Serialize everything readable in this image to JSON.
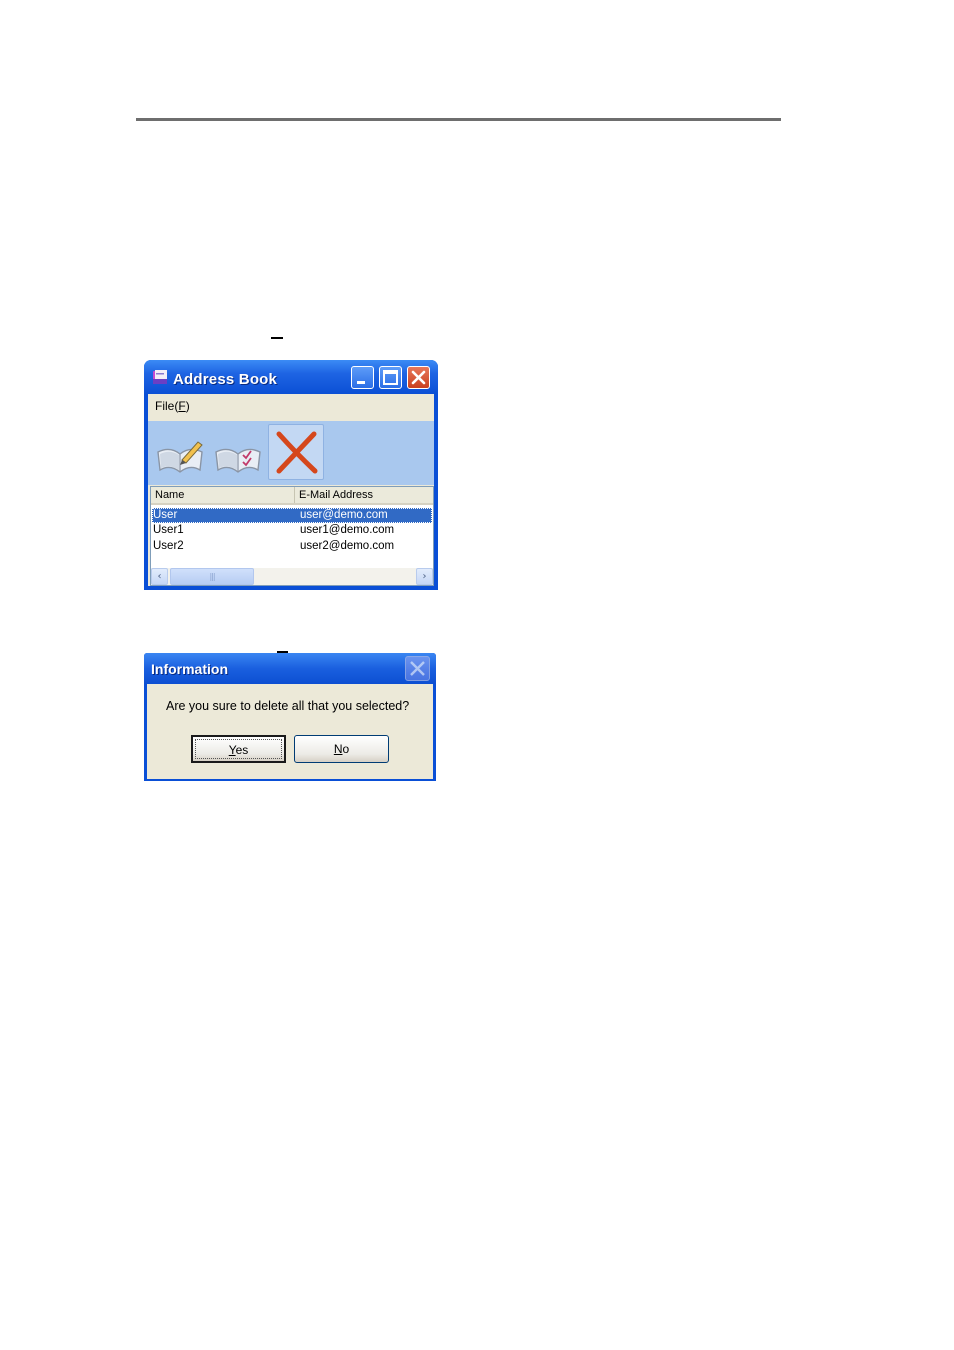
{
  "address_book": {
    "title": "Address Book",
    "menu": {
      "file_label": "File(",
      "file_key": "F",
      "file_close": ")"
    },
    "toolbar": [
      {
        "name": "new-contact-button",
        "icon": "book-pencil-icon"
      },
      {
        "name": "edit-contact-button",
        "icon": "book-checklist-icon"
      },
      {
        "name": "delete-contact-button",
        "icon": "delete-x-icon",
        "active": true
      }
    ],
    "columns": [
      "Name",
      "E-Mail Address"
    ],
    "rows": [
      {
        "name": "User",
        "email": "user@demo.com",
        "selected": true
      },
      {
        "name": "User1",
        "email": "user1@demo.com",
        "selected": false
      },
      {
        "name": "User2",
        "email": "user2@demo.com",
        "selected": false
      }
    ],
    "scroll": {
      "left": "‹",
      "right": "›",
      "grip": "|||"
    }
  },
  "dialog": {
    "title": "Information",
    "message": "Are you sure to delete all that you selected?",
    "yes_key": "Y",
    "yes_rest": "es",
    "no_key": "N",
    "no_rest": "o"
  },
  "colors": {
    "titlebar": "#0b50d5",
    "selection": "#316ac5",
    "toolbar_bg": "#a9c8ee",
    "face": "#ece9d8"
  }
}
